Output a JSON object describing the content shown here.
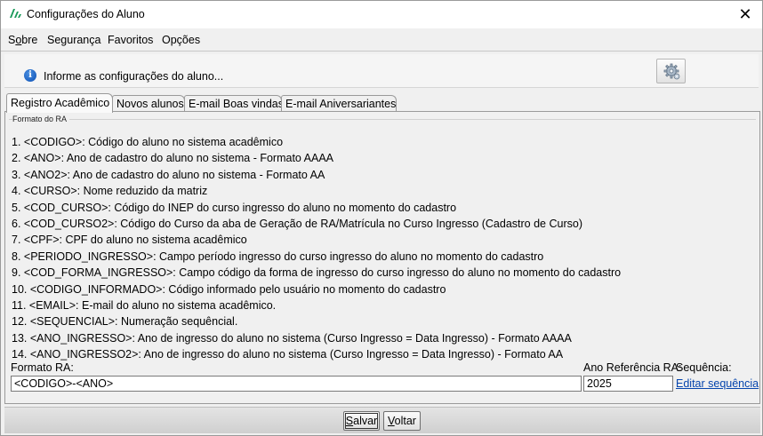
{
  "window": {
    "title": "Configurações do Aluno",
    "close_label": "✕"
  },
  "menu": {
    "items": [
      {
        "pre": "S",
        "u": "o",
        "post": "bre"
      },
      {
        "pre": "Segurança",
        "u": "",
        "post": ""
      },
      {
        "pre": "Favoritos",
        "u": "",
        "post": ""
      },
      {
        "pre": "Opções",
        "u": "",
        "post": ""
      }
    ]
  },
  "header": {
    "info_text": "Informe as configurações do aluno...",
    "settings_icon": "gear-icon"
  },
  "tabs": [
    {
      "label": "Registro Acadêmico",
      "active": true
    },
    {
      "label": "Novos alunos",
      "active": false
    },
    {
      "label": "E-mail Boas vindas",
      "active": false
    },
    {
      "label": "E-mail Aniversariantes",
      "active": false
    }
  ],
  "group": {
    "legend": "Formato do RA"
  },
  "fields": [
    "1. <CODIGO>: Código do aluno no sistema acadêmico",
    "2. <ANO>: Ano de cadastro do aluno no sistema - Formato AAAA",
    "3. <ANO2>: Ano de cadastro do aluno no sistema - Formato AA",
    "4. <CURSO>: Nome reduzido da matriz",
    "5. <COD_CURSO>: Código do INEP do curso ingresso do aluno no momento do cadastro",
    "6. <COD_CURSO2>: Código do Curso da aba de Geração de RA/Matrícula no Curso Ingresso (Cadastro de Curso)",
    "7. <CPF>: CPF do aluno no sistema acadêmico",
    "8. <PERIODO_INGRESSO>: Campo período ingresso do curso ingresso do aluno no momento do cadastro",
    "9. <COD_FORMA_INGRESSO>: Campo código da forma de ingresso do curso ingresso do aluno no momento do cadastro",
    "10. <CODIGO_INFORMADO>: Código informado pelo usuário no momento do cadastro",
    "11. <EMAIL>: E-mail do aluno no sistema acadêmico.",
    "12. <SEQUENCIAL>: Numeração sequêncial.",
    "13. <ANO_INGRESSO>: Ano de ingresso do aluno no sistema (Curso Ingresso = Data Ingresso) - Formato AAAA",
    "14. <ANO_INGRESSO2>: Ano de ingresso do aluno no sistema (Curso Ingresso = Data Ingresso) - Formato AA"
  ],
  "form": {
    "formato_label": "Formato RA:",
    "formato_value": "<CODIGO>-<ANO>",
    "ano_ref_label": "Ano Referência RA:",
    "ano_ref_value": "2025",
    "sequencia_label": "Sequência:",
    "editar_link": "Editar sequência"
  },
  "footer": {
    "salvar": {
      "u": "S",
      "rest": "alvar"
    },
    "voltar": {
      "u": "V",
      "rest": "oltar"
    }
  },
  "colors": {
    "link": "#0645ad",
    "info_icon": "#0b4fb5"
  }
}
